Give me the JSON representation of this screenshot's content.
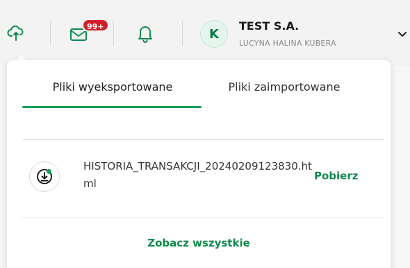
{
  "header": {
    "notification_badge": "99+",
    "avatar_initial": "K",
    "company_name": "TEST S.A.",
    "user_name": "LUCYNA HALINA KUBERA"
  },
  "icons": {
    "export": "cloud-upload-icon",
    "messages": "mail-icon",
    "notifications": "bell-icon",
    "menu": "chevron-down-icon",
    "file": "download-circle-icon"
  },
  "panel": {
    "tabs": [
      {
        "label": "Pliki wyeksportowane",
        "active": true
      },
      {
        "label": "Pliki zaimportowane",
        "active": false
      }
    ],
    "files": [
      {
        "name": "HISTORIA_TRANSAKCJI_20240209123830.html",
        "action": "Pobierz"
      }
    ],
    "see_all": "Zobacz wszystkie"
  },
  "colors": {
    "accent": "#15a05a",
    "link": "#0f8a4d",
    "badge": "#d11f2a"
  }
}
